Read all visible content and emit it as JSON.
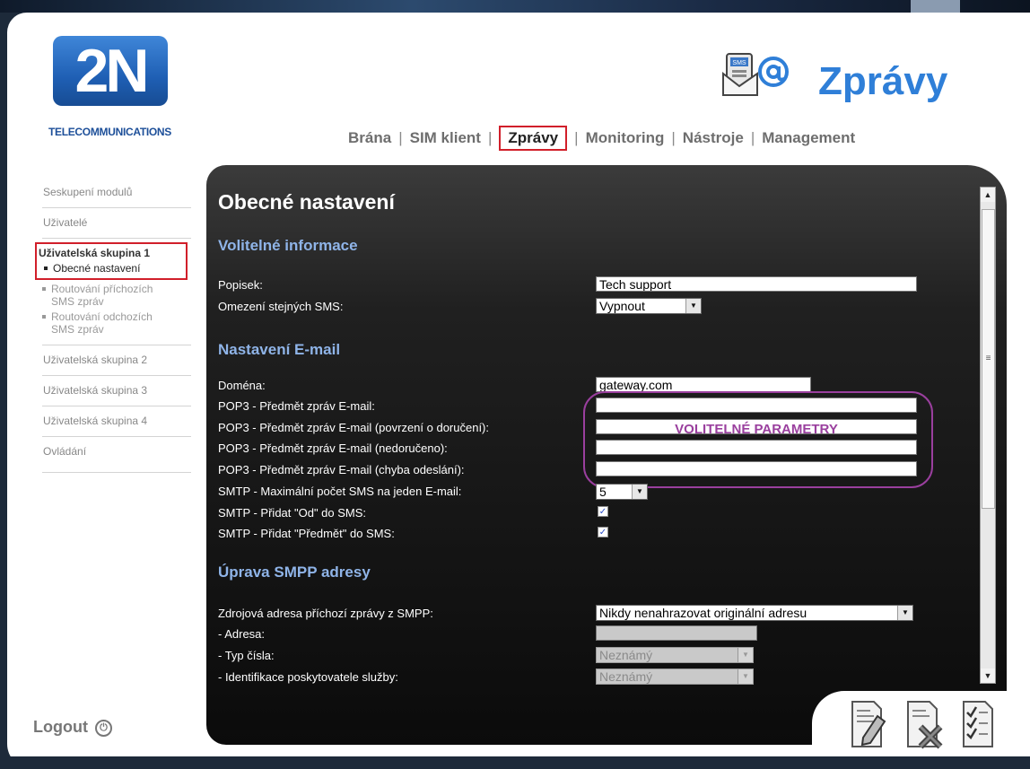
{
  "header": {
    "logo_main": "2N",
    "logo_sub": "TELECOMMUNICATIONS",
    "app_title": "Zprávy",
    "app_icon_badge": "SMS"
  },
  "nav": {
    "items": [
      "Brána",
      "SIM klient",
      "Zprávy",
      "Monitoring",
      "Nástroje",
      "Management"
    ],
    "separator": "|",
    "active": "Zprávy"
  },
  "sidebar": {
    "items": [
      "Seskupení modulů",
      "Uživatelé"
    ],
    "group_header": "Uživatelská skupina 1",
    "group_sub": [
      "Obecné nastavení",
      "Routování příchozích SMS zpráv",
      "Routování odchozích SMS zpráv"
    ],
    "items_after": [
      "Uživatelská skupina 2",
      "Uživatelská skupina 3",
      "Uživatelská skupina 4",
      "Ovládání"
    ],
    "logout": "Logout"
  },
  "main": {
    "title": "Obecné nastavení",
    "section1": "Volitelné informace",
    "popisek_label": "Popisek:",
    "popisek_value": "Tech support",
    "omezeni_label": "Omezení stejných SMS:",
    "omezeni_value": "Vypnout",
    "section2": "Nastavení E-mail",
    "domena_label": "Doména:",
    "domena_value": "gateway.com",
    "pop3_1": "POP3 - Předmět zpráv E-mail:",
    "pop3_2": "POP3 - Předmět zpráv E-mail (povrzení o doručení):",
    "pop3_3": "POP3 - Předmět zpráv E-mail (nedoručeno):",
    "pop3_4": "POP3 - Předmět zpráv E-mail (chyba odeslání):",
    "optional_note": "VOLITELNÉ PARAMETRY",
    "smtp_max_label": "SMTP - Maximální počet SMS na jeden E-mail:",
    "smtp_max_value": "5",
    "smtp_od_label": "SMTP - Přidat \"Od\" do SMS:",
    "smtp_predmet_label": "SMTP - Přidat \"Předmět\" do SMS:",
    "smtp_od_checked": true,
    "smtp_predmet_checked": true,
    "section3": "Úprava SMPP adresy",
    "zdroj_label": "Zdrojová adresa příchozí zprávy z SMPP:",
    "zdroj_value": "Nikdy nenahrazovat originální adresu",
    "adresa_label": "- Adresa:",
    "typ_label": "- Typ čísla:",
    "typ_value": "Neznámý",
    "ident_label": "- Identifikace poskytovatele služby:",
    "ident_value": "Neznámý"
  },
  "colors": {
    "accent_blue": "#2f7fd8",
    "section_blue": "#8fb4e8",
    "highlight_red": "#d11f2a",
    "note_purple": "#9a3f9e"
  },
  "icons": [
    "edit-document-icon",
    "delete-document-icon",
    "checklist-icon",
    "logout-power-icon",
    "sms-email-icon"
  ]
}
